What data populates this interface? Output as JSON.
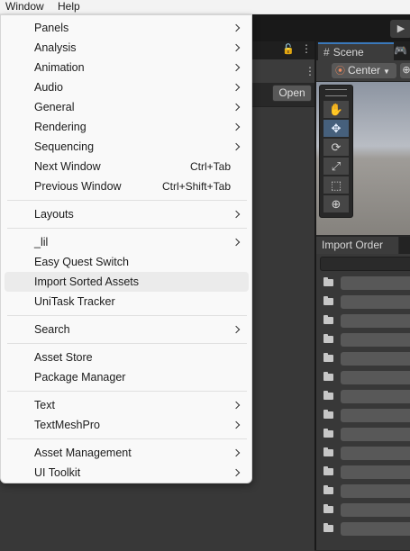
{
  "menubar": {
    "items": [
      "Window",
      "Help"
    ]
  },
  "editor": {
    "scene_tab": "Scene",
    "pivot_label": "Center",
    "open_button": "Open",
    "import_tab": "Import Order",
    "import_rows": 14
  },
  "window_menu": {
    "groups": [
      [
        {
          "label": "Panels",
          "submenu": true
        },
        {
          "label": "Analysis",
          "submenu": true
        },
        {
          "label": "Animation",
          "submenu": true
        },
        {
          "label": "Audio",
          "submenu": true
        },
        {
          "label": "General",
          "submenu": true
        },
        {
          "label": "Rendering",
          "submenu": true
        },
        {
          "label": "Sequencing",
          "submenu": true
        },
        {
          "label": "Next Window",
          "shortcut": "Ctrl+Tab"
        },
        {
          "label": "Previous Window",
          "shortcut": "Ctrl+Shift+Tab"
        }
      ],
      [
        {
          "label": "Layouts",
          "submenu": true
        }
      ],
      [
        {
          "label": "_lil",
          "submenu": true
        },
        {
          "label": "Easy Quest Switch"
        },
        {
          "label": "Import Sorted Assets",
          "highlighted": true
        },
        {
          "label": "UniTask Tracker"
        }
      ],
      [
        {
          "label": "Search",
          "submenu": true
        }
      ],
      [
        {
          "label": "Asset Store"
        },
        {
          "label": "Package Manager"
        }
      ],
      [
        {
          "label": "Text",
          "submenu": true
        },
        {
          "label": "TextMeshPro",
          "submenu": true
        }
      ],
      [
        {
          "label": "Asset Management",
          "submenu": true
        },
        {
          "label": "UI Toolkit",
          "submenu": true
        }
      ]
    ]
  }
}
